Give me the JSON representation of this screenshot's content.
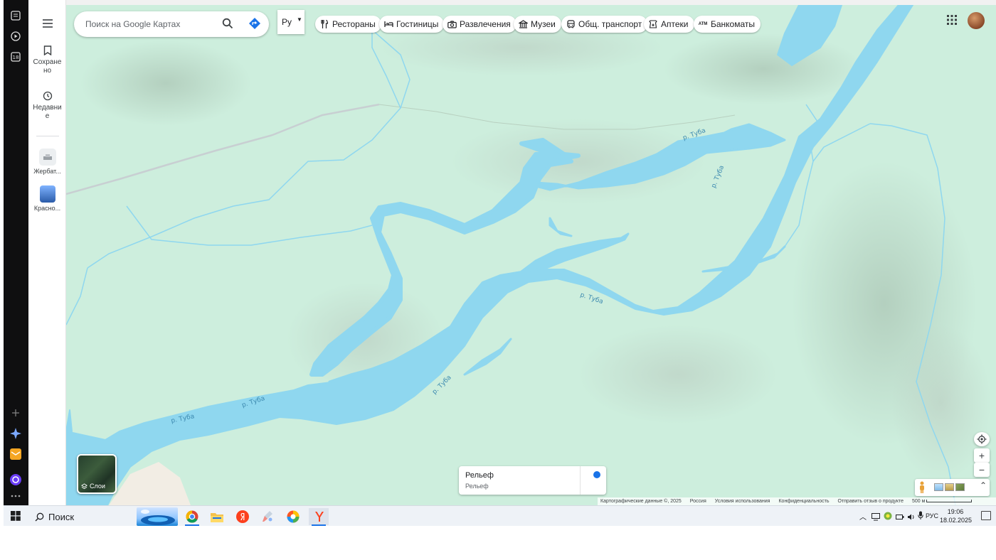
{
  "search": {
    "placeholder": "Поиск на Google Картах"
  },
  "language": {
    "selected": "Ру"
  },
  "rail": {
    "saved_label": "Сохранено",
    "recent_label": "Недавние",
    "recent_items": [
      {
        "label": "Жербат..."
      },
      {
        "label": "Красно..."
      }
    ]
  },
  "chips": [
    {
      "label": "Рестораны",
      "icon": "fork-knife-icon"
    },
    {
      "label": "Гостиницы",
      "icon": "bed-icon"
    },
    {
      "label": "Развлечения",
      "icon": "camera-icon"
    },
    {
      "label": "Музеи",
      "icon": "museum-icon"
    },
    {
      "label": "Общ. транспорт",
      "icon": "bus-icon"
    },
    {
      "label": "Аптеки",
      "icon": "pharmacy-icon"
    },
    {
      "label": "Банкоматы",
      "icon": "atm-icon"
    }
  ],
  "map": {
    "river_labels": [
      "р. Туба",
      "р. Туба",
      "р. Туба",
      "р. Туба",
      "р. Туба",
      "р. Туба"
    ],
    "water_color": "#8fd7ef",
    "land_color": "#cdeedd"
  },
  "layers": {
    "label": "Слои"
  },
  "relief": {
    "title": "Рельеф",
    "subtitle": "Рельеф"
  },
  "attribution": {
    "data": "Картографические данные ©, 2025",
    "country": "Россия",
    "terms": "Условия использования",
    "privacy": "Конфиденциальность",
    "feedback": "Отправить отзыв о продукте",
    "scale": "500 м"
  },
  "controls": {
    "zoom_in": "+",
    "zoom_out": "−",
    "expand": "⌃"
  },
  "taskbar": {
    "search_placeholder": "Поиск",
    "lang": "РУС",
    "time": "19:06",
    "date": "18.02.2025"
  }
}
